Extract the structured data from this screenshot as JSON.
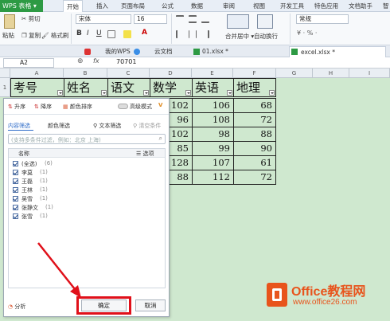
{
  "app": {
    "name": "WPS 表格"
  },
  "ribbon_tabs": [
    "开始",
    "插入",
    "页面布局",
    "公式",
    "数据",
    "审阅",
    "视图",
    "开发工具",
    "特色应用",
    "文档助手",
    "智"
  ],
  "ribbon": {
    "cut": "剪切",
    "paste": "粘贴",
    "copy": "复制",
    "format_painter": "格式刷",
    "font": "宋体",
    "font_size": "16",
    "merge": "合并居中",
    "wrap": "自动换行",
    "number_format": "常规"
  },
  "doc_tabs": [
    "我的WPS",
    "云文档",
    "01.xlsx *",
    "excel.xlsx *"
  ],
  "formula_bar": {
    "name_box": "A2",
    "fx": "fx",
    "value": "70701"
  },
  "columns": [
    "A",
    "B",
    "C",
    "D",
    "E",
    "F",
    "G",
    "H",
    "I"
  ],
  "rows": [
    "1"
  ],
  "headers": [
    "考号",
    "姓名",
    "语文",
    "数学",
    "英语",
    "地理"
  ],
  "data_rows": [
    {
      "math": "102",
      "english": "106",
      "geo": "68"
    },
    {
      "math": "96",
      "english": "108",
      "geo": "72"
    },
    {
      "math": "102",
      "english": "98",
      "geo": "88"
    },
    {
      "math": "85",
      "english": "99",
      "geo": "90"
    },
    {
      "math": "128",
      "english": "107",
      "geo": "61"
    },
    {
      "math": "88",
      "english": "112",
      "geo": "72"
    }
  ],
  "filter_panel": {
    "sort_asc": "升序",
    "sort_desc": "降序",
    "sort_color": "颜色排序",
    "advanced": "高级模式",
    "tab_content": "内容筛选",
    "tab_color": "颜色筛选",
    "text_filter": "文本筛选",
    "clear": "清空条件",
    "search_placeholder": "(支持多条件过滤，例如：北京 上海)",
    "list_header": "名称",
    "options": "选项",
    "items": [
      {
        "label": "(全选)",
        "count": "(6)"
      },
      {
        "label": "李莫",
        "count": "(1)"
      },
      {
        "label": "王磊",
        "count": "(1)"
      },
      {
        "label": "王林",
        "count": "(1)"
      },
      {
        "label": "吴雪",
        "count": "(1)"
      },
      {
        "label": "张静文",
        "count": "(1)"
      },
      {
        "label": "张雪",
        "count": "(1)"
      }
    ],
    "analyze": "分析",
    "ok": "确定",
    "cancel": "取消"
  },
  "watermark": {
    "brand": "Office教程网",
    "url": "www.office26.com"
  },
  "colors": {
    "app_green": "#2d9a44",
    "sheet_green": "#cfe8cf",
    "highlight_red": "#e0101a",
    "watermark_orange": "#e8541c"
  }
}
